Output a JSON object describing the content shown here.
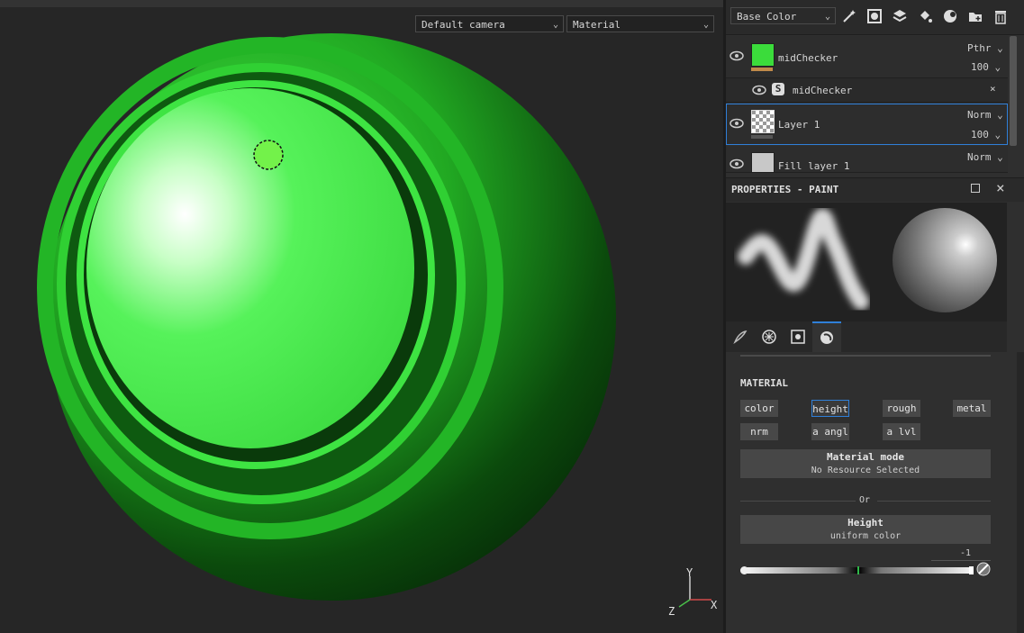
{
  "viewport": {
    "camera_dropdown": "Default camera",
    "mode_dropdown": "Material",
    "gizmo": {
      "y_label": "Y",
      "x_label": "X",
      "z_label": "Z"
    }
  },
  "toolbar": {
    "channel_dropdown": "Base Color",
    "icons": [
      "magic-wand-icon",
      "mask-icon",
      "add-layer-icon",
      "fill-icon",
      "effect-icon",
      "add-folder-icon",
      "delete-icon"
    ]
  },
  "layers": [
    {
      "name": "midChecker",
      "blend": "Pthr",
      "opacity": "100",
      "thumb_color": "#3bdc3b",
      "bar_color": "#c08a4a"
    },
    {
      "name": "midChecker",
      "sub": true,
      "close": "×"
    },
    {
      "name": "Layer 1",
      "blend": "Norm",
      "opacity": "100",
      "selected": true
    },
    {
      "name": "Fill layer 1",
      "blend": "Norm"
    }
  ],
  "properties": {
    "title": "PROPERTIES - PAINT",
    "tabs": [
      "brush-tab-icon",
      "alpha-tab-icon",
      "stencil-tab-icon",
      "material-tab-icon"
    ],
    "material_title": "MATERIAL",
    "chips": [
      "color",
      "height",
      "rough",
      "metal",
      "nrm",
      "a angl",
      "a lvl"
    ],
    "active_chip": "height",
    "material_mode": {
      "title": "Material mode",
      "subtitle": "No Resource Selected"
    },
    "or_label": "Or",
    "height": {
      "title": "Height",
      "subtitle": "uniform color"
    },
    "slider_value": "-1",
    "slider_level": 0.5
  },
  "colors": {
    "accent": "#2f7fd8",
    "sphere_green": "#35e03a"
  }
}
